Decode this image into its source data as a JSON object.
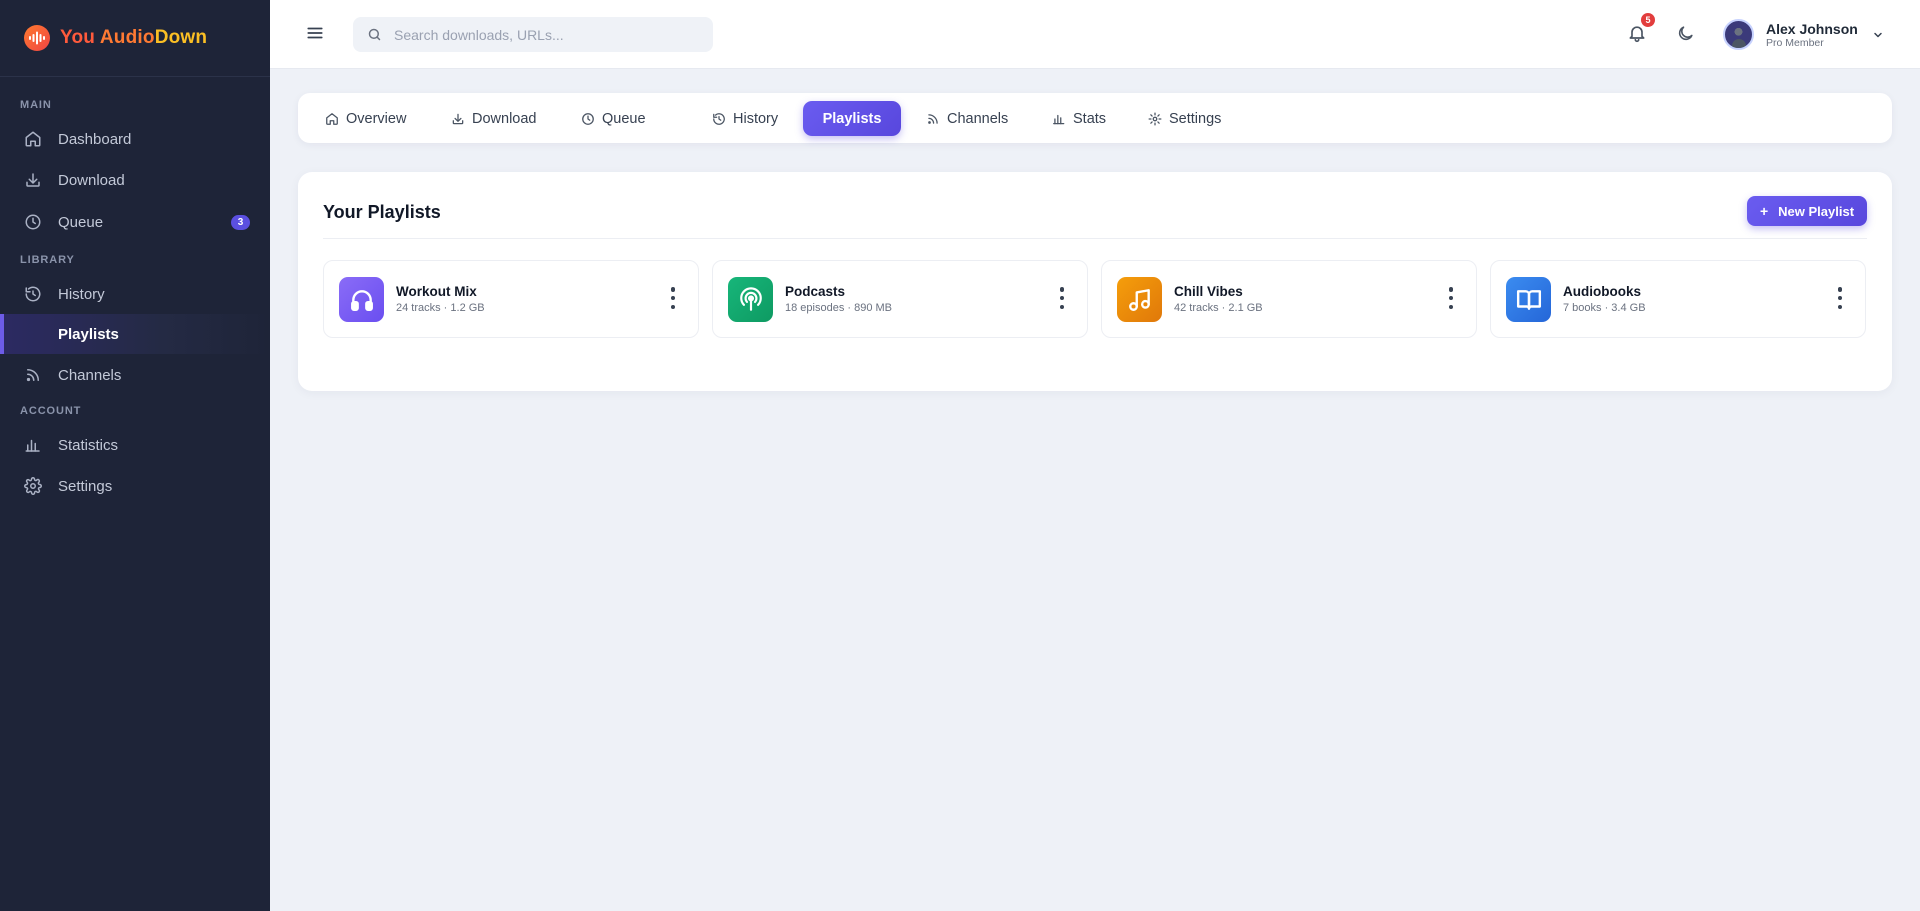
{
  "brand": {
    "part1": "You ",
    "part2": "Audio",
    "part3": "Down"
  },
  "sidebar": {
    "sections": {
      "main": "MAIN",
      "library": "LIBRARY",
      "account": "ACCOUNT"
    },
    "items": [
      {
        "label": "Dashboard",
        "icon": "home-icon"
      },
      {
        "label": "Download",
        "icon": "download-icon"
      },
      {
        "label": "Queue",
        "icon": "clock-icon",
        "badge": "3"
      },
      {
        "label": "History",
        "icon": "history-icon"
      },
      {
        "label": "Playlists",
        "icon": "playlist-icon",
        "active": true
      },
      {
        "label": "Channels",
        "icon": "rss-icon"
      },
      {
        "label": "Statistics",
        "icon": "bar-chart-icon"
      },
      {
        "label": "Settings",
        "icon": "gear-icon"
      }
    ]
  },
  "topbar": {
    "search_placeholder": "Search downloads, URLs...",
    "search_value": "",
    "notifications_count": "5",
    "user": {
      "name": "Alex Johnson",
      "role": "Pro Member"
    }
  },
  "tabs": [
    {
      "label": "Overview",
      "icon": "home-icon"
    },
    {
      "label": "Download",
      "icon": "download-icon"
    },
    {
      "label": "Queue",
      "icon": "clock-icon"
    },
    {
      "label": "History",
      "icon": "history-icon"
    },
    {
      "label": "Playlists",
      "active": true
    },
    {
      "label": "Channels",
      "icon": "rss-icon"
    },
    {
      "label": "Stats",
      "icon": "bar-chart-icon"
    },
    {
      "label": "Settings",
      "icon": "gear-icon"
    }
  ],
  "playlists_panel": {
    "title": "Your Playlists",
    "new_button": "New Playlist",
    "cards": [
      {
        "name": "Workout Mix",
        "meta": "24 tracks · 1.2 GB",
        "icon": "headphones-icon",
        "color": "#7c5cf5"
      },
      {
        "name": "Podcasts",
        "meta": "18 episodes · 890 MB",
        "icon": "podcast-icon",
        "color": "#10a86c"
      },
      {
        "name": "Chill Vibes",
        "meta": "42 tracks · 2.1 GB",
        "icon": "music-note-icon",
        "color": "#f08a0c"
      },
      {
        "name": "Audiobooks",
        "meta": "7 books · 3.4 GB",
        "icon": "book-icon",
        "color": "#2f7be6"
      }
    ]
  },
  "colors": {
    "sidebar_bg": "#1e2438",
    "accent": "#6a5cf0",
    "notification_badge": "#e23d3d",
    "page_bg": "#eef1f7"
  }
}
